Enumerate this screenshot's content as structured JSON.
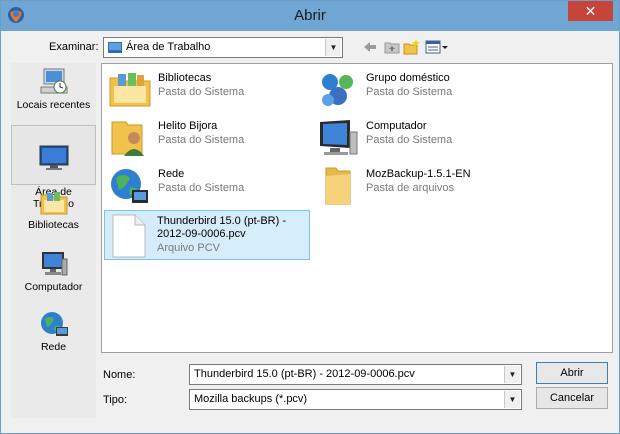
{
  "window": {
    "title": "Abrir",
    "close_label": "✕"
  },
  "toolbar": {
    "lookin_label": "Examinar:",
    "lookin_value": "Área de Trabalho"
  },
  "places": [
    {
      "label": "Locais recentes"
    },
    {
      "label": "Área de\nTrabalho"
    },
    {
      "label": "Bibliotecas"
    },
    {
      "label": "Computador"
    },
    {
      "label": "Rede"
    }
  ],
  "items": [
    {
      "name": "Bibliotecas",
      "sub": "Pasta do Sistema"
    },
    {
      "name": "Grupo doméstico",
      "sub": "Pasta do Sistema"
    },
    {
      "name": "Helito Bijora",
      "sub": "Pasta do Sistema"
    },
    {
      "name": "Computador",
      "sub": "Pasta do Sistema"
    },
    {
      "name": "Rede",
      "sub": "Pasta do Sistema"
    },
    {
      "name": "MozBackup-1.5.1-EN",
      "sub": "Pasta de arquivos"
    },
    {
      "name": "Thunderbird 15.0 (pt-BR) -",
      "name2": "2012-09-0006.pcv",
      "sub": "Arquivo PCV"
    }
  ],
  "form": {
    "name_label": "Nome:",
    "name_value": "Thunderbird 15.0 (pt-BR) - 2012-09-0006.pcv",
    "type_label": "Tipo:",
    "type_value": "Mozilla backups (*.pcv)",
    "open_label": "Abrir",
    "cancel_label": "Cancelar"
  },
  "colors": {
    "titlebar": "#6fa6d3",
    "close": "#c7443a",
    "selection": "#d5ecfa"
  }
}
